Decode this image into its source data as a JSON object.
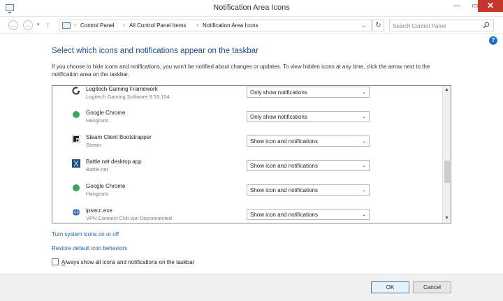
{
  "window": {
    "title": "Notification Area Icons",
    "minimize": "—",
    "maximize": "▭",
    "close": "✕"
  },
  "address": {
    "back": "←",
    "forward": "→",
    "history_drop": "▾",
    "up": "↑",
    "crumbs": [
      "Control Panel",
      "All Control Panel Items",
      "Notification Area Icons"
    ],
    "separator": "›",
    "path_drop": "⌄",
    "refresh": "↻",
    "search_placeholder": "Search Control Panel"
  },
  "help": "?",
  "page": {
    "heading": "Select which icons and notifications appear on the taskbar",
    "description": "If you choose to hide icons and notifications, you won't be notified about changes or updates. To view hidden icons at any time, click the arrow next to the notification area on the taskbar."
  },
  "rows": [
    {
      "name": "Logitech Gaming Framework",
      "sub": "Logitech Gaming Software 8.53.154",
      "value": "Only show notifications",
      "icon": "logitech-icon",
      "color": "#333333"
    },
    {
      "name": "Google Chrome",
      "sub": "Hangouts",
      "value": "Only show notifications",
      "icon": "hangouts-icon",
      "color": "#3aa757"
    },
    {
      "name": "Steam Client Bootstrapper",
      "sub": "Steam",
      "value": "Show icon and notifications",
      "icon": "steam-icon",
      "color": "#222222"
    },
    {
      "name": "Battle.net desktop app",
      "sub": "Battle.net",
      "value": "Show icon and notifications",
      "icon": "battlenet-icon",
      "color": "#1f4f7a"
    },
    {
      "name": "Google Chrome",
      "sub": "Hangouts",
      "value": "Show icon and notifications",
      "icon": "hangouts-icon",
      "color": "#3aa757"
    },
    {
      "name": "ipsecc.exe",
      "sub": "VPN Connect CMI.vpn Disconnected",
      "value": "Show icon and notifications",
      "icon": "vpn-globe-icon",
      "color": "#2a5ea8"
    }
  ],
  "scroll": {
    "up": "▲",
    "down": "▼",
    "position": 0.68
  },
  "select_arrow": "⌄",
  "links": {
    "system_icons": "Turn system icons on or off",
    "restore": "Restore default icon behaviors"
  },
  "checkbox": {
    "label_underlined": "A",
    "label_rest": "lways show all icons and notifications on the taskbar",
    "checked": false
  },
  "buttons": {
    "ok": "OK",
    "cancel": "Cancel"
  },
  "colors": {
    "heading": "#1e4f91",
    "link": "#1a5fb4",
    "close_button": "#c7362d"
  }
}
